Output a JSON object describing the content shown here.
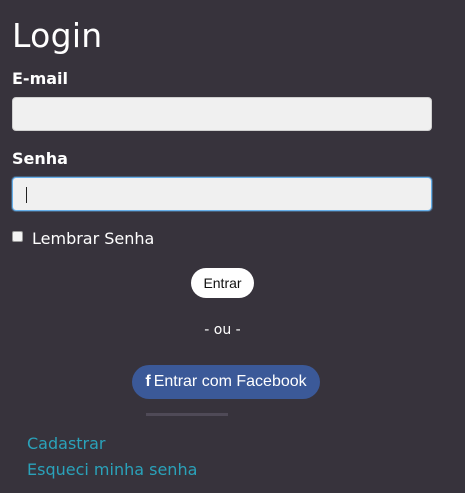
{
  "form": {
    "title": "Login",
    "email_label": "E-mail",
    "email_value": "",
    "password_label": "Senha",
    "password_value": "",
    "remember_label": "Lembrar Senha",
    "remember_checked": false,
    "submit_label": "Entrar",
    "separator": "- ou -",
    "facebook_icon": "f",
    "facebook_label": "Entrar com Facebook"
  },
  "links": {
    "register": "Cadastrar",
    "forgot_password": "Esqueci minha senha"
  },
  "colors": {
    "background": "#37333c",
    "facebook_button": "#3b5998",
    "link": "#2aa2ba",
    "focus_border": "#66afe9"
  },
  "icons": {
    "facebook": "facebook-icon"
  }
}
